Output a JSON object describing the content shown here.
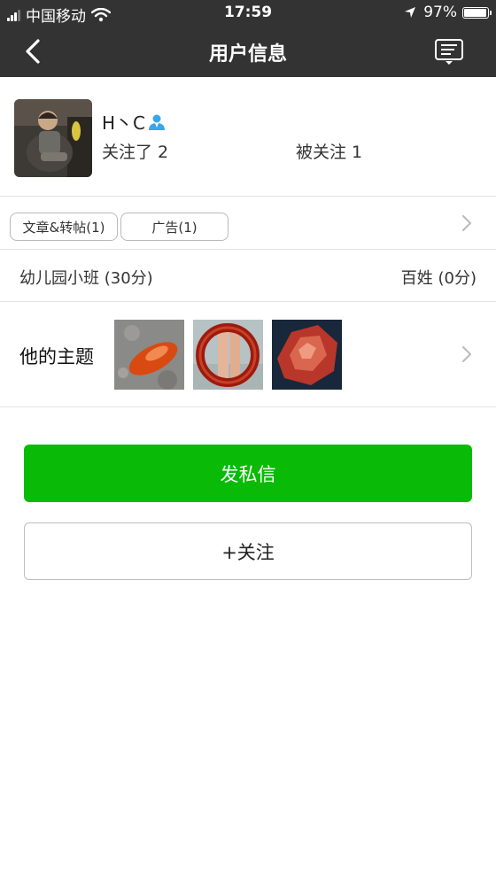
{
  "status_bar": {
    "carrier": "中国移动",
    "time": "17:59",
    "battery": "97%"
  },
  "nav": {
    "title": "用户信息",
    "back_icon": "chevron-left-icon",
    "menu_icon": "message-list-icon"
  },
  "profile": {
    "name": "H丶C",
    "following": "关注了 2",
    "followers": "被关注 1"
  },
  "tabs": [
    {
      "label": "文章&转帖(1)"
    },
    {
      "label": "广告(1)"
    }
  ],
  "levels": {
    "left": "幼儿园小班 (30分)",
    "right": "百姓 (0分)"
  },
  "topics": {
    "label": "他的主题"
  },
  "actions": {
    "message": "发私信",
    "follow": "+关注"
  },
  "colors": {
    "bar": "#333333",
    "accent_green": "#09bb07",
    "verified_blue": "#3aa6e8"
  }
}
